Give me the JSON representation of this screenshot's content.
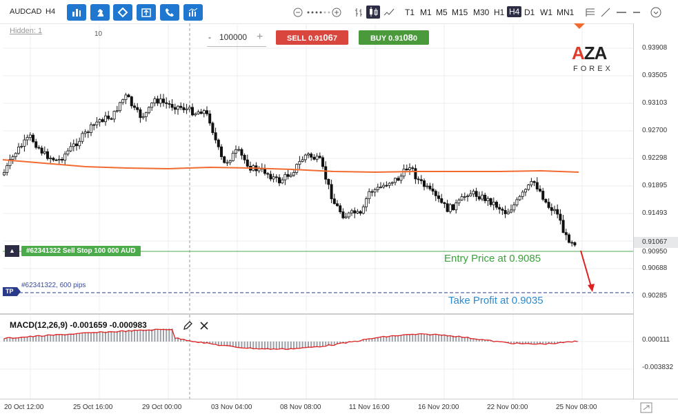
{
  "toolbar": {
    "symbol": "AUDCAD",
    "period": "H4",
    "timeframes": [
      "T1",
      "M1",
      "M5",
      "M15",
      "M30",
      "H1",
      "H4",
      "D1",
      "W1",
      "MN1"
    ],
    "active_timeframe": "H4"
  },
  "trade_panel": {
    "hidden_label": "Hidden: 1",
    "lot_marker": "10",
    "minus": "-",
    "quantity": "100000",
    "plus": "+",
    "sell_prefix": "SELL 0.91",
    "sell_big": "06",
    "sell_suffix": "7",
    "buy_prefix": "BUY 0.91",
    "buy_big": "08",
    "buy_suffix": "0"
  },
  "logo": {
    "text_main": "AZA",
    "text_sub": "FOREX"
  },
  "price_axis": {
    "labels": [
      "0.93908",
      "0.93505",
      "0.93103",
      "0.92700",
      "0.92298",
      "0.91895",
      "0.91493",
      "0.91067",
      "0.90950",
      "0.90688",
      "0.90285"
    ],
    "current_price": "0.91067",
    "order_price": "0.90950"
  },
  "order": {
    "handle": "≡",
    "tag": "#62341322 Sell Stop 100 000 AUD",
    "tp_handle": "TP",
    "tp_text": "#62341322, 600 pips"
  },
  "annotations": {
    "entry": "Entry Price at 0.9085",
    "take_profit": "Take Profit at 0.9035"
  },
  "macd": {
    "label": "MACD(12,26,9) -0.001659 -0.000983",
    "axis_labels": [
      "0.000111",
      "-0.003832"
    ]
  },
  "date_axis": [
    "20 Oct 12:00",
    "25 Oct 16:00",
    "29 Oct 00:00",
    "03 Nov 04:00",
    "08 Nov 08:00",
    "11 Nov 16:00",
    "16 Nov 20:00",
    "22 Nov 00:00",
    "25 Nov 08:00"
  ],
  "colors": {
    "sell": "#d9463e",
    "buy": "#4a9a3c",
    "toolbar_button": "#1f77d0",
    "ma_line": "#f26a30",
    "macd_signal": "#e02020",
    "order_line": "#4bab4b",
    "tp_line": "#2a3a8a",
    "arrow": "#e02020"
  }
}
